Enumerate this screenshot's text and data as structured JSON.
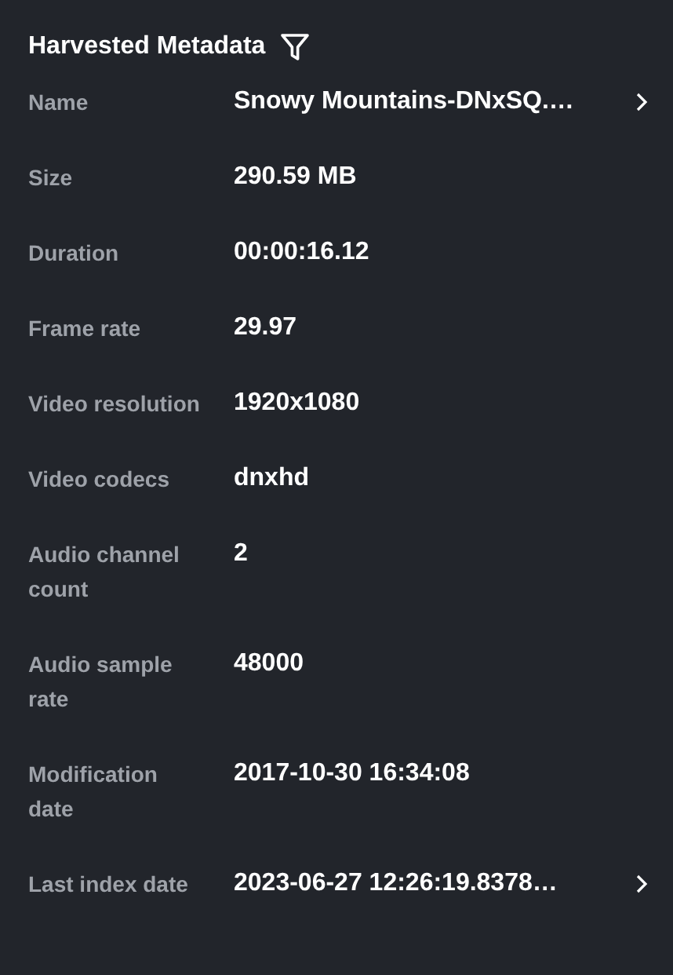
{
  "panel": {
    "title": "Harvested Metadata"
  },
  "rows": [
    {
      "label": "Name",
      "value": "Snowy Mountains-DNxSQ.…",
      "expandable": true
    },
    {
      "label": "Size",
      "value": "290.59 MB",
      "expandable": false
    },
    {
      "label": "Duration",
      "value": "00:00:16.12",
      "expandable": false
    },
    {
      "label": "Frame rate",
      "value": "29.97",
      "expandable": false
    },
    {
      "label": "Video resolution",
      "value": "1920x1080",
      "expandable": false
    },
    {
      "label": "Video codecs",
      "value": "dnxhd",
      "expandable": false
    },
    {
      "label": "Audio channel count",
      "value": "2",
      "expandable": false
    },
    {
      "label": "Audio sample rate",
      "value": "48000",
      "expandable": false
    },
    {
      "label": "Modification date",
      "value": "2017-10-30 16:34:08",
      "expandable": false
    },
    {
      "label": "Last index date",
      "value": "2023-06-27 12:26:19.8378…",
      "expandable": true
    }
  ]
}
